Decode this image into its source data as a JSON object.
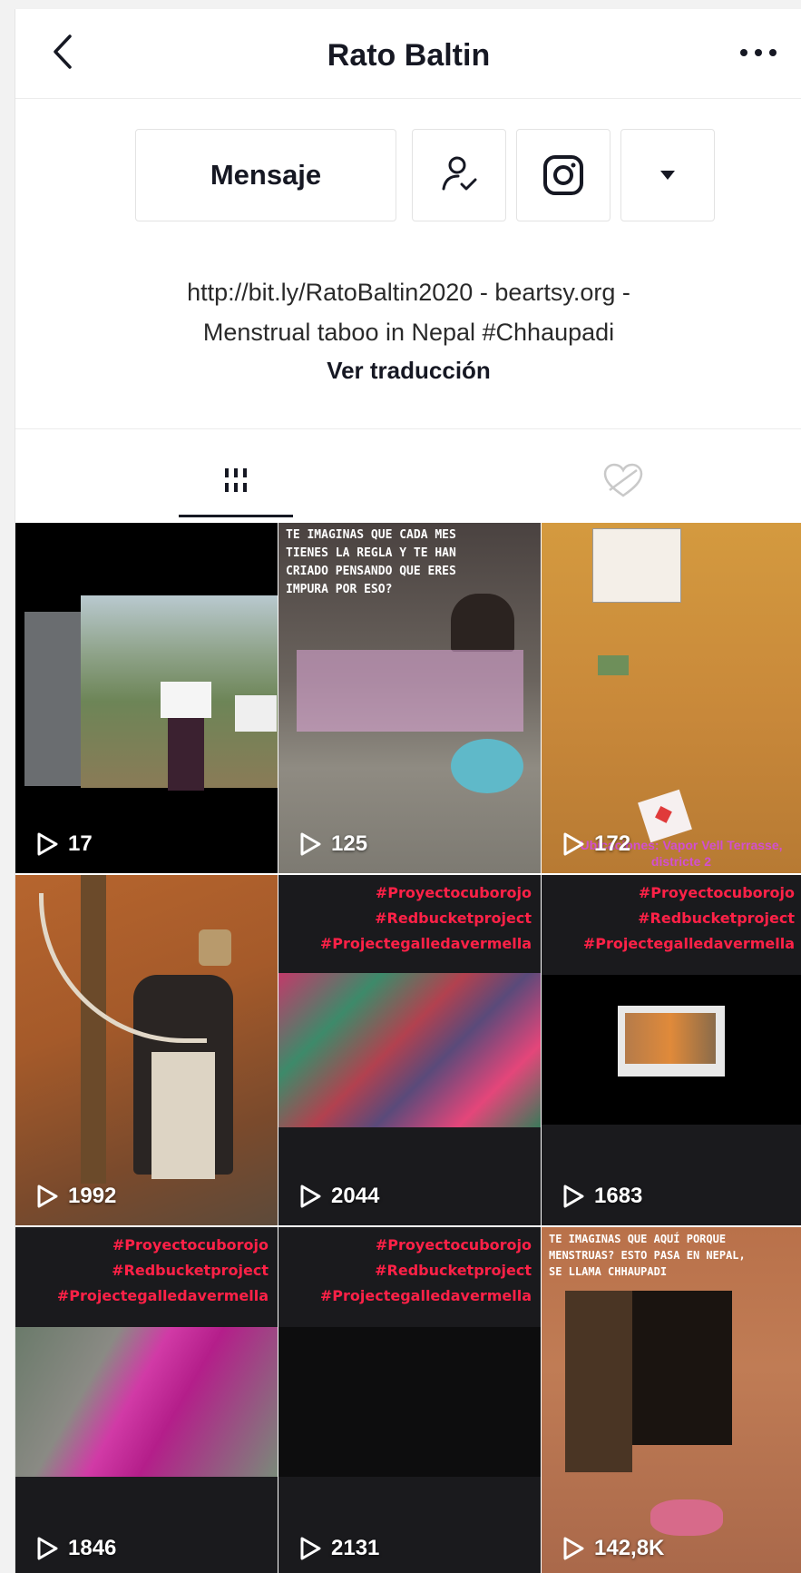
{
  "header": {
    "title": "Rato Baltin"
  },
  "actions": {
    "message_label": "Mensaje"
  },
  "bio": {
    "line1": "http://bit.ly/RatoBaltin2020 - beartsy.org -",
    "line2": "Menstrual taboo in Nepal #Chhaupadi",
    "translate_label": "Ver traducción"
  },
  "icons": {
    "back": "chevron-left-icon",
    "more": "ellipsis-icon",
    "follow": "person-check-icon",
    "instagram": "instagram-icon",
    "dropdown": "caret-down-icon",
    "videos_tab": "grid-icon",
    "liked_tab": "heart-hidden-icon",
    "play": "play-icon"
  },
  "hashtags": [
    "#Proyectocuborojo",
    "#Redbucketproject",
    "#Projectegalledavermella"
  ],
  "videos": [
    {
      "views": "17"
    },
    {
      "views": "125",
      "overlay_text": "TE IMAGINAS QUE CADA MES TIENES LA REGLA Y TE HAN CRIADO PENSANDO QUE ERES IMPURA POR ESO?"
    },
    {
      "views": "172",
      "overlay_text": "Ubicaciones: Vapor Vell Terrasse, districte 2"
    },
    {
      "views": "1992"
    },
    {
      "views": "2044"
    },
    {
      "views": "1683"
    },
    {
      "views": "1846"
    },
    {
      "views": "2131"
    },
    {
      "views": "142,8K",
      "overlay_text": "TE IMAGINAS QUE AQUÍ PORQUE MENSTRUAS? ESTO PASA EN NEPAL, SE LLAMA CHHAUPADI"
    }
  ],
  "colors": {
    "accent_hashtag": "#ff2147",
    "text_primary": "#161823"
  }
}
